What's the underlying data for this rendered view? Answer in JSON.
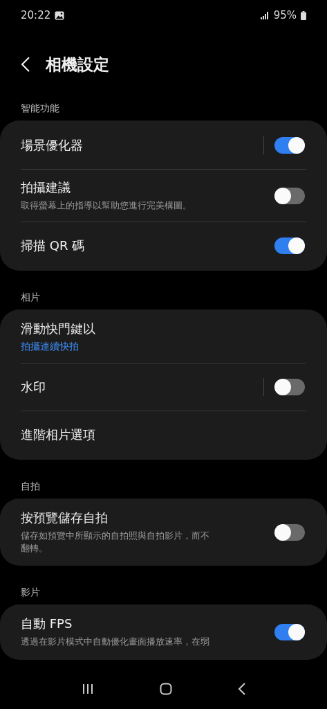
{
  "status_bar": {
    "time": "20:22",
    "battery": "95%"
  },
  "header": {
    "title": "相機設定"
  },
  "sections": [
    {
      "title": "智能功能",
      "items": [
        {
          "kind": "toggle",
          "title": "場景優化器",
          "split": true,
          "on": true
        },
        {
          "kind": "toggle",
          "title": "拍攝建議",
          "subtitle": "取得螢幕上的指導以幫助您進行完美構圖。",
          "split": false,
          "on": false
        },
        {
          "kind": "toggle",
          "title": "掃描 QR 碼",
          "split": false,
          "on": true
        }
      ]
    },
    {
      "title": "相片",
      "items": [
        {
          "kind": "link",
          "title": "滑動快門鍵以",
          "value": "拍攝連續快拍"
        },
        {
          "kind": "toggle",
          "title": "水印",
          "split": true,
          "on": false
        },
        {
          "kind": "plain",
          "title": "進階相片選項"
        }
      ]
    },
    {
      "title": "自拍",
      "items": [
        {
          "kind": "toggle",
          "title": "按預覽儲存自拍",
          "subtitle": "儲存如預覽中所顯示的自拍照與自拍影片，而不翻轉。",
          "split": false,
          "on": false
        }
      ]
    },
    {
      "title": "影片",
      "items": [
        {
          "kind": "toggle",
          "title": "自動 FPS",
          "subtitle": "透過在影片模式中自動優化畫面播放速率，在弱",
          "split": false,
          "on": true
        }
      ]
    }
  ]
}
